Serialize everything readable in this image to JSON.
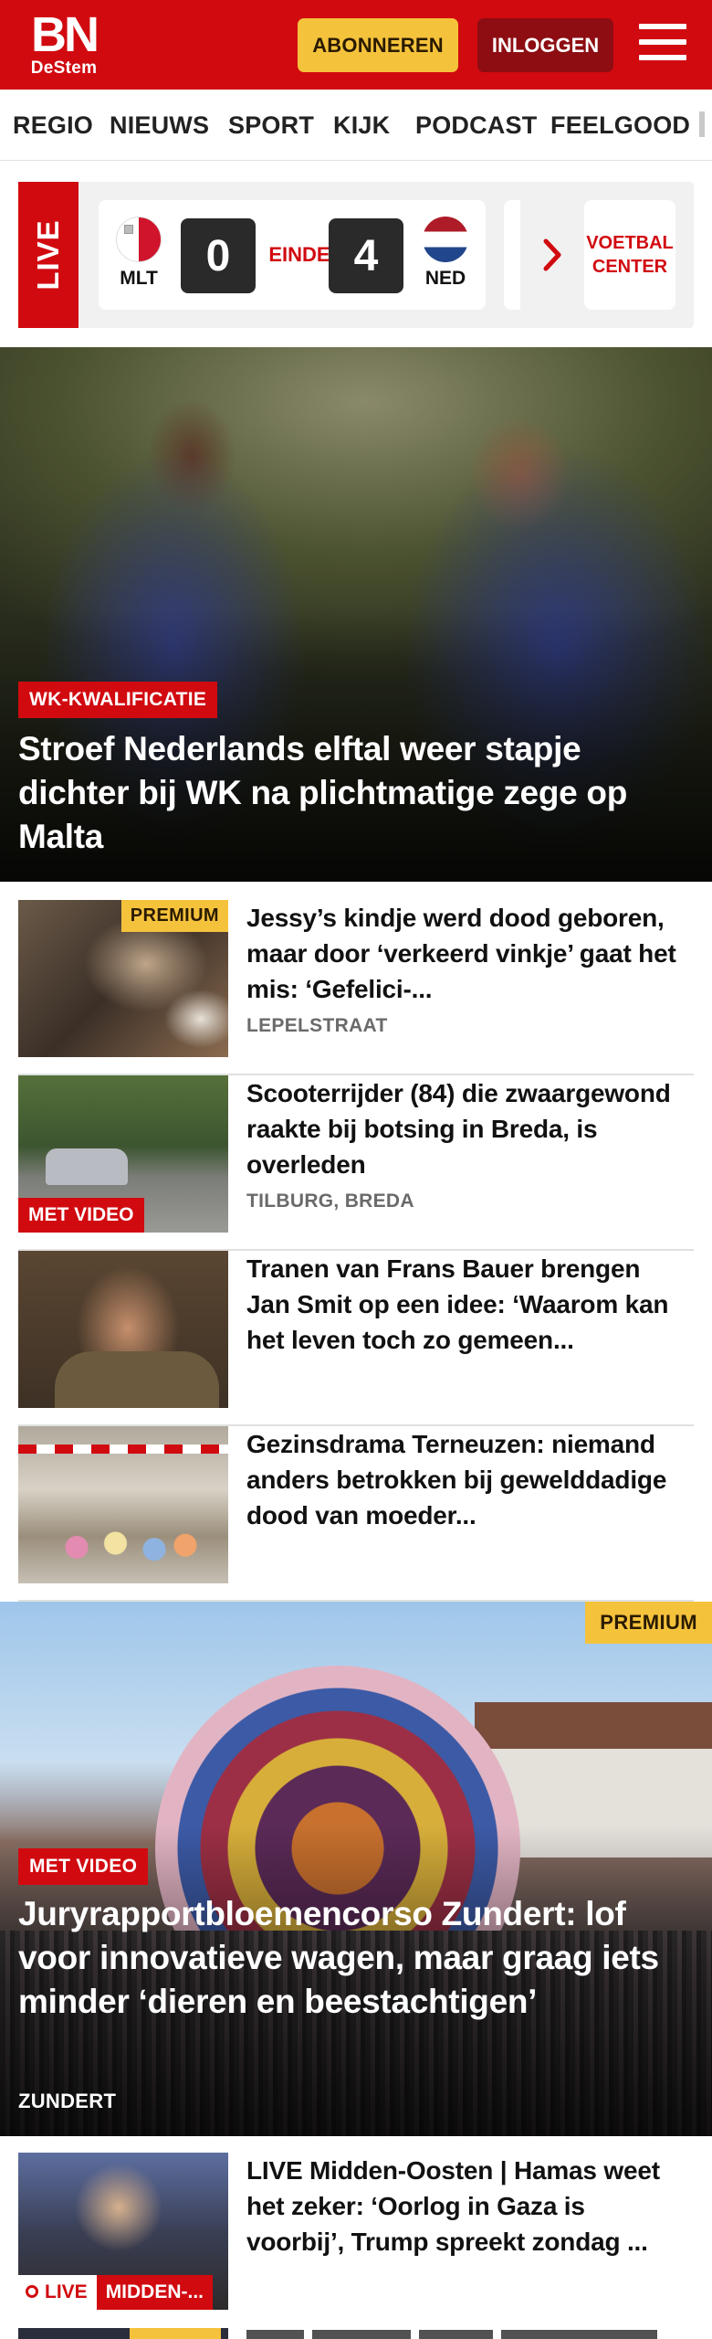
{
  "header": {
    "logo_main": "BN",
    "logo_sub": "DeStem",
    "subscribe_label": "ABONNEREN",
    "login_label": "INLOGGEN",
    "menu_icon": "hamburger-menu-icon"
  },
  "nav": {
    "items": [
      "REGIO",
      "NIEUWS",
      "SPORT",
      "KIJK",
      "PODCAST",
      "FEELGOOD"
    ]
  },
  "live": {
    "label": "LIVE",
    "match": {
      "home_code": "MLT",
      "home_score": "0",
      "status": "EINDE",
      "away_score": "4",
      "away_code": "NED"
    },
    "next_icon": "chevron-right-icon",
    "center_label": "VOETBAL CENTER"
  },
  "hero": {
    "tag": "WK-KWALIFICATIE",
    "title": "Stroef Nederlands elftal weer stapje dichter bij WK na plichtmatige zege op Malta"
  },
  "articles": [
    {
      "title": "Jessy’s kindje werd dood geboren, maar door ‘verkeerd vinkje’ gaat het mis: ‘Gefelici-...",
      "location": "LEPELSTRAAT",
      "badge": "PREMIUM"
    },
    {
      "title": "Scooterrijder (84) die zwaargewond raakte bij botsing in Breda, is overleden",
      "location": "TILBURG, BREDA",
      "badge": "MET VIDEO"
    },
    {
      "title": "Tranen van Frans Bauer brengen Jan Smit op een idee: ‘Waarom kan het leven toch zo gemeen...",
      "location": ""
    },
    {
      "title": "Gezinsdrama Terneuzen: niemand anders betrokken bij gewelddadige dood van moeder...",
      "location": ""
    }
  ],
  "hero2": {
    "premium": "PREMIUM",
    "tag": "MET VIDEO",
    "title": "Juryrapportbloemencorso Zundert: lof voor innovatieve wagen, maar graag iets minder ‘dieren en beestachtigen’",
    "location": "ZUNDERT"
  },
  "live_article": {
    "title": "LIVE Midden-Oosten | Hamas weet het zeker: ‘Oorlog in Gaza is voorbij’, Trump spreekt zondag ...",
    "live_label": "LIVE",
    "category": "MIDDEN-..."
  },
  "colors": {
    "brand_red": "#d10a10",
    "premium_yellow": "#f5c23c",
    "login_dark_red": "#8d0d12"
  }
}
